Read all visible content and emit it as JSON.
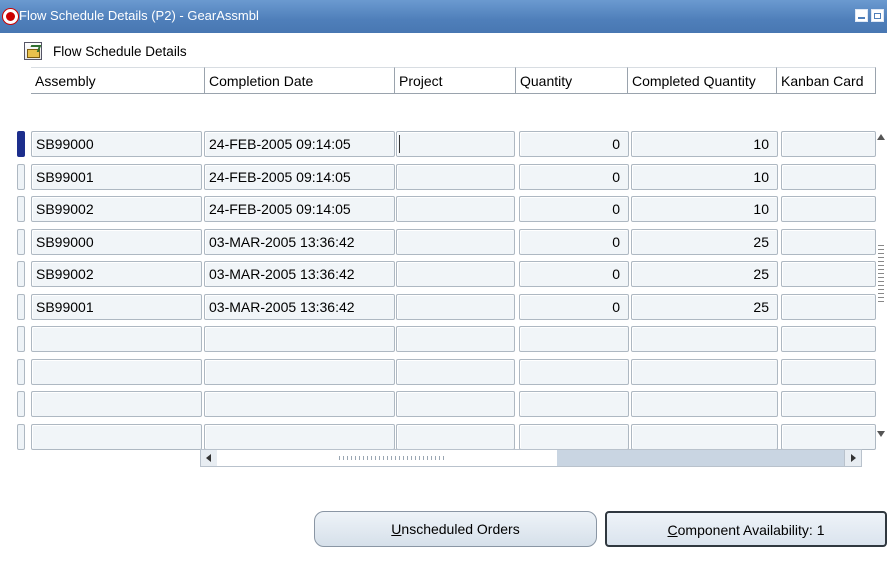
{
  "window": {
    "title": "Flow Schedule Details (P2) - GearAssmbl",
    "accent_color": "#4f7fba"
  },
  "section": {
    "icon": "open-folder-icon",
    "title": "Flow Schedule Details"
  },
  "table": {
    "columns": [
      "Assembly",
      "Completion Date",
      "Project",
      "Quantity",
      "Completed Quantity",
      "Kanban Card"
    ],
    "rows": [
      {
        "assembly": "SB99000",
        "completion_date": "24-FEB-2005 09:14:05",
        "project": "",
        "quantity": "0",
        "completed_quantity": "10",
        "kanban_card": ""
      },
      {
        "assembly": "SB99001",
        "completion_date": "24-FEB-2005 09:14:05",
        "project": "",
        "quantity": "0",
        "completed_quantity": "10",
        "kanban_card": ""
      },
      {
        "assembly": "SB99002",
        "completion_date": "24-FEB-2005 09:14:05",
        "project": "",
        "quantity": "0",
        "completed_quantity": "10",
        "kanban_card": ""
      },
      {
        "assembly": "SB99000",
        "completion_date": "03-MAR-2005 13:36:42",
        "project": "",
        "quantity": "0",
        "completed_quantity": "25",
        "kanban_card": ""
      },
      {
        "assembly": "SB99002",
        "completion_date": "03-MAR-2005 13:36:42",
        "project": "",
        "quantity": "0",
        "completed_quantity": "25",
        "kanban_card": ""
      },
      {
        "assembly": "SB99001",
        "completion_date": "03-MAR-2005 13:36:42",
        "project": "",
        "quantity": "0",
        "completed_quantity": "25",
        "kanban_card": ""
      },
      {
        "assembly": "",
        "completion_date": "",
        "project": "",
        "quantity": "",
        "completed_quantity": "",
        "kanban_card": ""
      },
      {
        "assembly": "",
        "completion_date": "",
        "project": "",
        "quantity": "",
        "completed_quantity": "",
        "kanban_card": ""
      },
      {
        "assembly": "",
        "completion_date": "",
        "project": "",
        "quantity": "",
        "completed_quantity": "",
        "kanban_card": ""
      },
      {
        "assembly": "",
        "completion_date": "",
        "project": "",
        "quantity": "",
        "completed_quantity": "",
        "kanban_card": ""
      }
    ],
    "current_row": 0
  },
  "buttons": {
    "unscheduled_mnemonic": "U",
    "unscheduled_rest": "nscheduled Orders",
    "component_mnemonic": "C",
    "component_rest": "omponent Availability: 1"
  }
}
